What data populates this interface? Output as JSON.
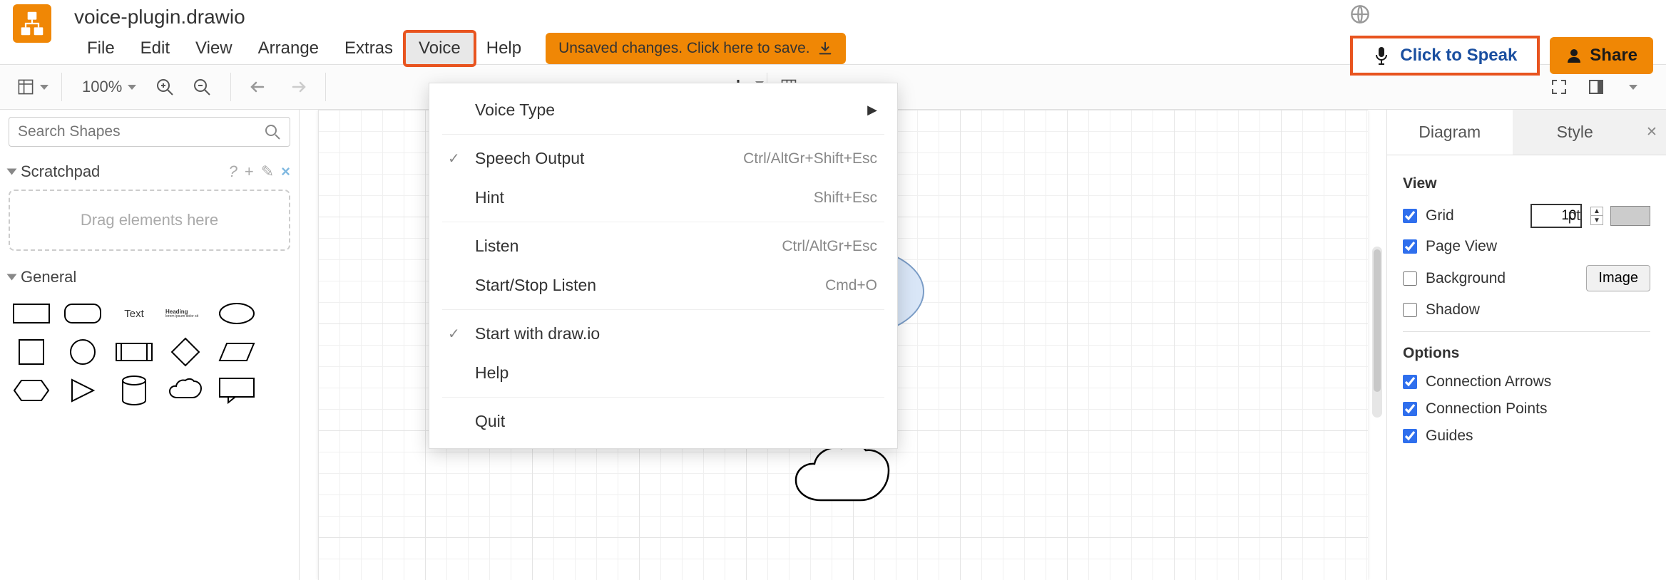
{
  "doc_title": "voice-plugin.drawio",
  "menus": [
    "File",
    "Edit",
    "View",
    "Arrange",
    "Extras",
    "Voice",
    "Help"
  ],
  "active_menu_index": 5,
  "unsaved_text": "Unsaved changes. Click here to save.",
  "speak_button": "Click to Speak",
  "share_button": "Share",
  "toolbar": {
    "zoom": "100%"
  },
  "search_placeholder": "Search Shapes",
  "scratchpad": {
    "title": "Scratchpad",
    "help_char": "?",
    "drag_text": "Drag elements here"
  },
  "general_title": "General",
  "shape_text_label": "Text",
  "shape_heading_label": "Heading",
  "voice_menu": {
    "voice_type": "Voice Type",
    "speech_output": "Speech Output",
    "speech_output_sc": "Ctrl/AltGr+Shift+Esc",
    "hint": "Hint",
    "hint_sc": "Shift+Esc",
    "listen": "Listen",
    "listen_sc": "Ctrl/AltGr+Esc",
    "startstop": "Start/Stop Listen",
    "startstop_sc": "Cmd+O",
    "startwith": "Start with draw.io",
    "help": "Help",
    "quit": "Quit"
  },
  "right_panel": {
    "tab_diagram": "Diagram",
    "tab_style": "Style",
    "section_view": "View",
    "grid_label": "Grid",
    "grid_value": "10",
    "grid_unit": "pt",
    "pageview_label": "Page View",
    "background_label": "Background",
    "image_btn": "Image",
    "shadow_label": "Shadow",
    "section_options": "Options",
    "conn_arrows": "Connection Arrows",
    "conn_points": "Connection Points",
    "guides": "Guides",
    "grid_checked": true,
    "pageview_checked": true,
    "background_checked": false,
    "shadow_checked": false,
    "conn_arrows_checked": true,
    "conn_points_checked": true,
    "guides_checked": true
  }
}
